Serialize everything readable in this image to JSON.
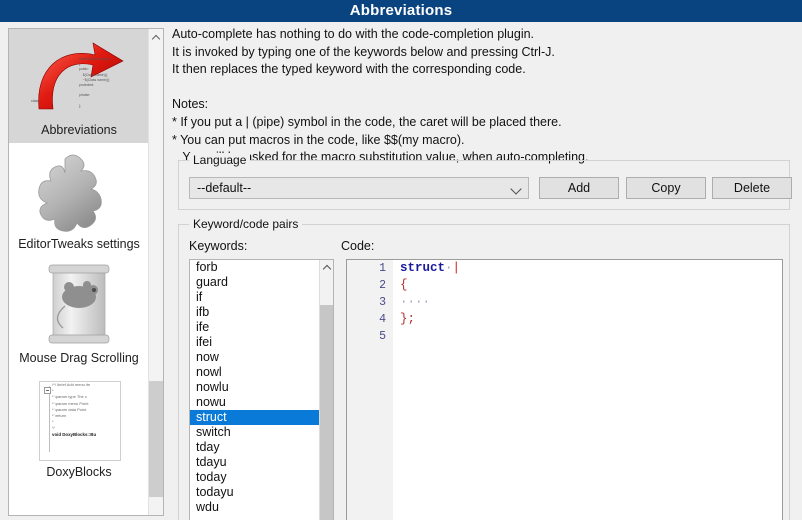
{
  "window": {
    "title": "Abbreviations"
  },
  "sidebar": {
    "items": [
      {
        "label": "Abbreviations",
        "icon": "red-curved-arrow-icon",
        "selected": true
      },
      {
        "label": "EditorTweaks settings",
        "icon": "puzzle-piece-icon",
        "selected": false
      },
      {
        "label": "Mouse Drag Scrolling",
        "icon": "mouse-on-scroll-icon",
        "selected": false
      },
      {
        "label": "DoxyBlocks",
        "icon": "doxygen-comment-icon",
        "selected": false
      }
    ],
    "abbr_icon_code": "class $(Class name)\n{\npublic:\n    $(Class name)();\n    ~$(Class name)();\nprotected:\n\nprivate:\n\n};",
    "abbr_icon_classword": "class",
    "doxy_lines": [
      "/*! \\brief Add menu ite",
      "*",
      "* \\param type   The c",
      "* \\param menu   Point",
      "* \\param data   Point",
      "* \\return",
      "*",
      "*/"
    ],
    "doxy_signature": "void DoxyBlocks::Bu",
    "scrollbar": {
      "up_arrow": "chevron-up-icon"
    }
  },
  "description": {
    "lines": [
      "Auto-complete has nothing to do with the code-completion plugin.",
      "It is invoked by typing one of the keywords below and pressing Ctrl-J.",
      "It then replaces the typed keyword with the corresponding code.",
      "",
      "Notes:",
      "* If you put a | (pipe) symbol in the code, the caret will be placed there.",
      "* You can put macros in the code, like $$(my macro).",
      "   You will be asked for the macro substitution value, when auto-completing."
    ]
  },
  "language_group": {
    "title": "Language",
    "combo": {
      "value": "--default--",
      "arrow_icon": "chevron-down-icon"
    },
    "buttons": {
      "add": "Add",
      "copy": "Copy",
      "delete": "Delete"
    }
  },
  "pairs_group": {
    "title": "Keyword/code pairs",
    "keywords_label": "Keywords:",
    "code_label": "Code:",
    "keywords": [
      {
        "text": "forb",
        "selected": false
      },
      {
        "text": "guard",
        "selected": false
      },
      {
        "text": "if",
        "selected": false
      },
      {
        "text": "ifb",
        "selected": false
      },
      {
        "text": "ife",
        "selected": false
      },
      {
        "text": "ifei",
        "selected": false
      },
      {
        "text": "now",
        "selected": false
      },
      {
        "text": "nowl",
        "selected": false
      },
      {
        "text": "nowlu",
        "selected": false
      },
      {
        "text": "nowu",
        "selected": false
      },
      {
        "text": "struct",
        "selected": true
      },
      {
        "text": "switch",
        "selected": false
      },
      {
        "text": "tday",
        "selected": false
      },
      {
        "text": "tdayu",
        "selected": false
      },
      {
        "text": "today",
        "selected": false
      },
      {
        "text": "todayu",
        "selected": false
      },
      {
        "text": "wdu",
        "selected": false
      }
    ],
    "code": {
      "line_numbers": [
        "1",
        "2",
        "3",
        "4",
        "5"
      ],
      "lines": [
        [
          {
            "t": "struct",
            "c": "kwd"
          },
          {
            "t": "·",
            "c": "dot"
          },
          {
            "t": "|",
            "c": "caret"
          }
        ],
        [
          {
            "t": "{",
            "c": "brace"
          }
        ],
        [
          {
            "t": "····",
            "c": "dot"
          }
        ],
        [
          {
            "t": "};",
            "c": "brace"
          }
        ],
        []
      ]
    }
  },
  "colors": {
    "titlebar": "#0a4480",
    "selection": "#0a7ad8",
    "window_bg": "#f0f0f0",
    "keyword": "#1a1a9e",
    "brace": "#b03030",
    "caret": "#cc2222"
  }
}
